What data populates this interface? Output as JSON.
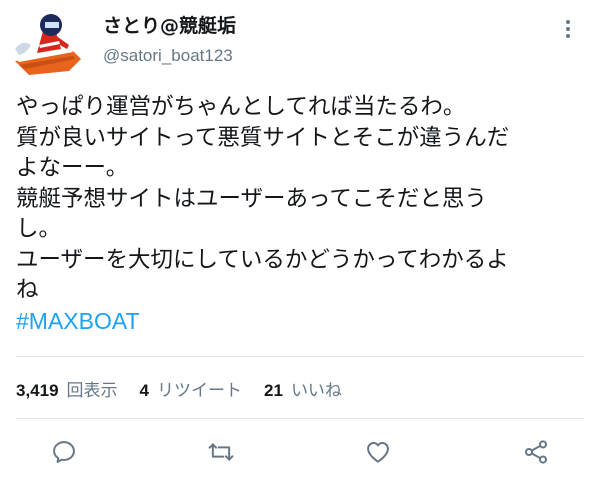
{
  "author": {
    "display_name": "さとり@競艇垢",
    "handle": "@satori_boat123"
  },
  "tweet": {
    "lines": [
      "やっぱり運営がちゃんとしてれば当たるわ。",
      "質が良いサイトって悪質サイトとそこが違うんだ",
      "よなーー。",
      "競艇予想サイトはユーザーあってこそだと思う",
      "し。",
      "ユーザーを大切にしているかどうかってわかるよ",
      "ね"
    ],
    "hashtag": "#MAXBOAT"
  },
  "stats": {
    "views_count": "3,419",
    "views_label": "回表示",
    "retweets_count": "4",
    "retweets_label": "リツイート",
    "likes_count": "21",
    "likes_label": "いいね"
  },
  "icons": {
    "reply": "reply-icon",
    "retweet": "retweet-icon",
    "like": "heart-icon",
    "share": "share-icon",
    "more": "more-vertical-icon"
  },
  "colors": {
    "text": "#14171a",
    "secondary": "#657786",
    "hashtag": "#1da1f2",
    "divider": "#e1e8ed",
    "boat_orange": "#e8641e",
    "racer_red": "#d7261e"
  }
}
